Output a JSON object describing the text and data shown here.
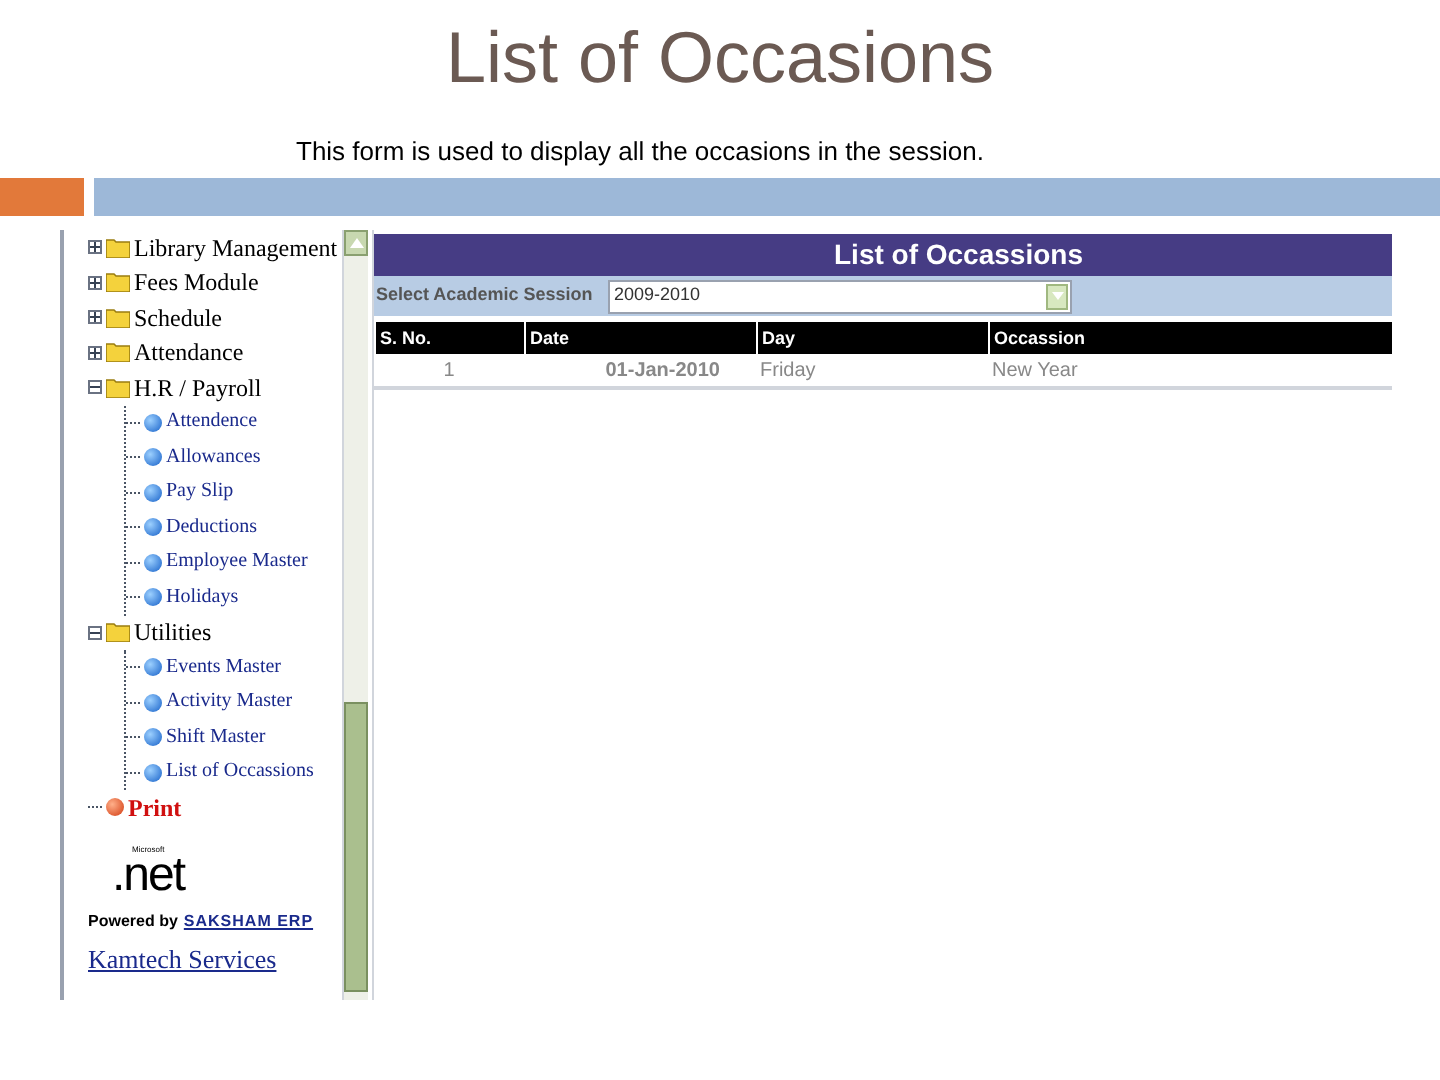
{
  "slide": {
    "title": "List of Occasions",
    "subtitle": "This form is used to display all the occasions in the session."
  },
  "sidebar": {
    "tree": [
      {
        "label": "Library Management",
        "kind": "folder",
        "expanded": false
      },
      {
        "label": "Fees Module",
        "kind": "folder",
        "expanded": false
      },
      {
        "label": "Schedule",
        "kind": "folder",
        "expanded": false
      },
      {
        "label": "Attendance",
        "kind": "folder",
        "expanded": false
      },
      {
        "label": "H.R / Payroll",
        "kind": "folder",
        "expanded": true,
        "children": [
          {
            "label": "Attendence",
            "kind": "page"
          },
          {
            "label": "Allowances",
            "kind": "page"
          },
          {
            "label": "Pay Slip",
            "kind": "page"
          },
          {
            "label": "Deductions",
            "kind": "page"
          },
          {
            "label": "Employee Master",
            "kind": "page"
          },
          {
            "label": "Holidays",
            "kind": "page"
          }
        ]
      },
      {
        "label": "Utilities",
        "kind": "folder",
        "expanded": true,
        "children": [
          {
            "label": "Events Master",
            "kind": "page"
          },
          {
            "label": "Activity Master",
            "kind": "page"
          },
          {
            "label": "Shift Master",
            "kind": "page"
          },
          {
            "label": "List of Occassions",
            "kind": "page"
          }
        ]
      },
      {
        "label": "Print",
        "kind": "print"
      }
    ],
    "logo_small": "Microsoft",
    "logo": ".net",
    "powered_by": "Powered by",
    "powered_link": "SAKSHAM ERP",
    "company": "Kamtech Services"
  },
  "form": {
    "title": "List of Occassions",
    "session_label": "Select Academic Session",
    "session_value": "2009-2010",
    "table": {
      "columns": [
        "S. No.",
        "Date",
        "Day",
        "Occassion"
      ],
      "rows": [
        [
          "1",
          "01-Jan-2010",
          "Friday",
          "New Year"
        ]
      ]
    }
  }
}
